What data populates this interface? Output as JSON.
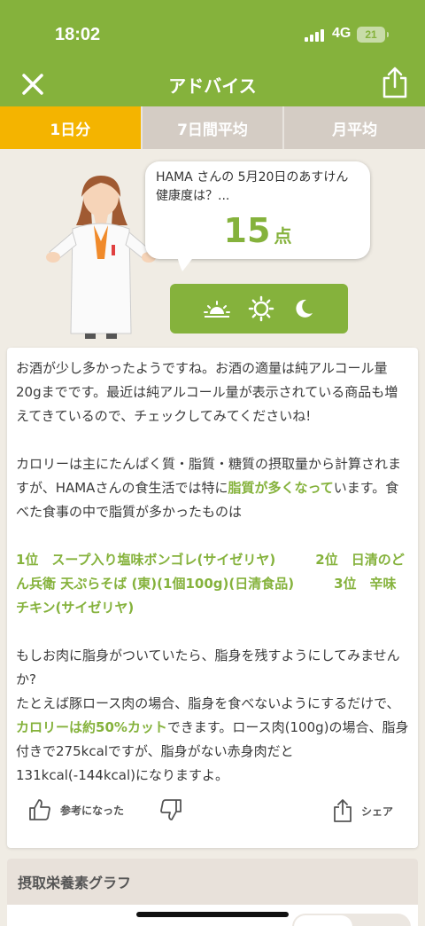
{
  "status_bar": {
    "time": "18:02",
    "network": "4G",
    "battery": "21"
  },
  "nav": {
    "title": "アドバイス",
    "close_icon": "close-icon",
    "share_icon": "share-icon"
  },
  "tabs": [
    {
      "label": "1日分",
      "active": true
    },
    {
      "label": "7日間平均",
      "active": false
    },
    {
      "label": "月平均",
      "active": false
    }
  ],
  "bubble": {
    "question": "HAMA さんの 5月20日のあすけん健康度は？...",
    "score": "15",
    "unit": "点"
  },
  "time_of_day_icons": [
    "sunrise-icon",
    "sun-icon",
    "moon-icon"
  ],
  "advice": {
    "p1": "お酒が少し多かったようですね。お酒の適量は純アルコール量20gまでです。最近は純アルコール量が表示されている商品も増えてきているので、チェックしてみてくださいね!",
    "p2_a": "カロリーは主にたんぱく質・脂質・糖質の摂取量から計算されますが、HAMAさんの食生活では特に",
    "p2_hl": "脂質が多くなって",
    "p2_b": "います。食べた食事の中で脂質が多かったものは",
    "rank1": "1位　スープ入り塩味ボンゴレ(サイゼリヤ)",
    "rank2": "2位　日清のどん兵衛 天ぷらそば (東)(1個100g)(日清食品)",
    "rank3": "3位　辛味チキン(サイゼリヤ)",
    "p4": "もしお肉に脂身がついていたら、脂身を残すようにしてみませんか?",
    "p5_a": "たとえば豚ロース肉の場合、脂身を食べないようにするだけで、",
    "p5_hl": "カロリーは約50%カット",
    "p5_b": "できます。ロース肉(100g)の場合、脂身付きで275kcalですが、脂身がない赤身肉だと131kcal(-144kcal)になりますよ。"
  },
  "actions": {
    "helpful": "参考になった",
    "share": "シェア"
  },
  "next_section": {
    "title": "摂取栄養素グラフ"
  },
  "colors": {
    "brand_green": "#85b23c",
    "active_tab": "#f4b400",
    "inactive_tab": "#d4ccc4",
    "background": "#f0ece4"
  }
}
